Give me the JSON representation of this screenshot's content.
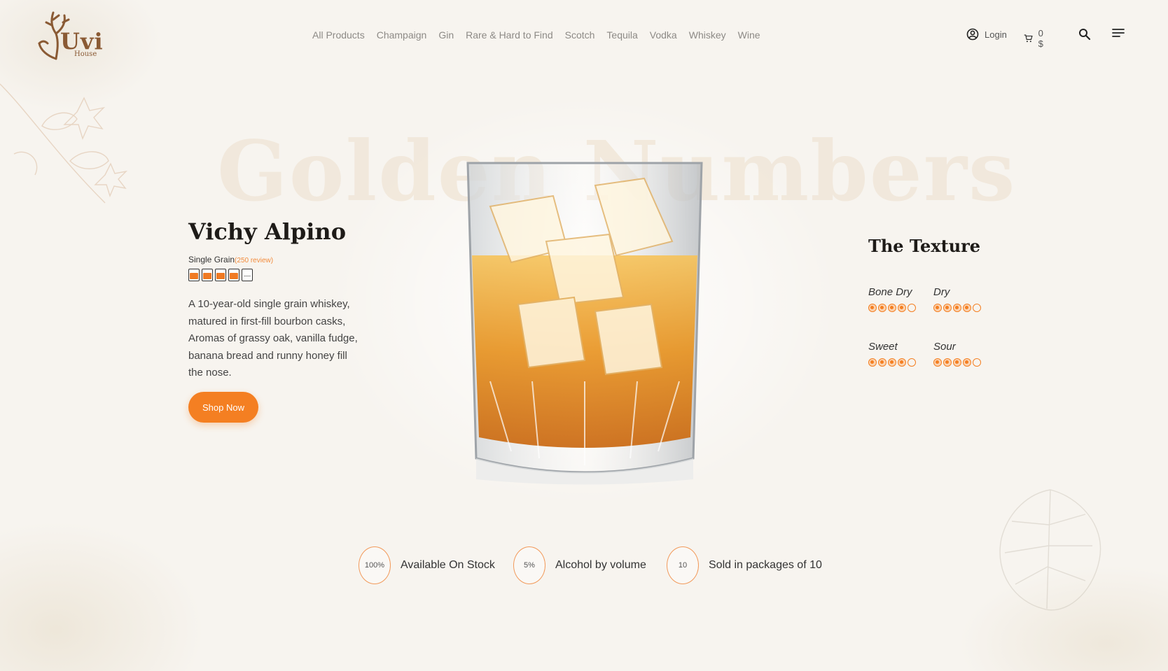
{
  "brand": {
    "logo_text": "Uvi",
    "logo_sub": "House"
  },
  "nav": {
    "items": [
      "All Products",
      "Champaign",
      "Gin",
      "Rare & Hard to Find",
      "Scotch",
      "Tequila",
      "Vodka",
      "Whiskey",
      "Wine"
    ]
  },
  "tools": {
    "login_label": "Login",
    "cart_total": "0 $"
  },
  "hero": {
    "watermark": "Golden Numbers"
  },
  "product": {
    "title": "Vichy Alpino",
    "category": "Single Grain",
    "reviews": "(250 review)",
    "rating": 4,
    "rating_max": 5,
    "description": "A 10-year-old single grain whiskey, matured in first-fill bourbon casks, Aromas of grassy oak, vanilla fudge, banana bread and runny honey fill the nose.",
    "cta_label": "Shop Now"
  },
  "texture": {
    "title": "The Texture",
    "items": [
      {
        "label": "Bone Dry",
        "value": 4,
        "max": 5
      },
      {
        "label": "Dry",
        "value": 4,
        "max": 5
      },
      {
        "label": "Sweet",
        "value": 4,
        "max": 5
      },
      {
        "label": "Sour",
        "value": 4,
        "max": 5
      }
    ]
  },
  "stats": [
    {
      "value": "100%",
      "label": "Available On Stock"
    },
    {
      "value": "5%",
      "label": "Alcohol by volume"
    },
    {
      "value": "10",
      "label": "Sold in packages of 10"
    }
  ],
  "colors": {
    "accent": "#f47f22",
    "brand": "#8a5a34",
    "watermark": "#f1e7d9"
  },
  "icons": {
    "login": "user-circle-icon",
    "cart": "cart-icon",
    "search": "search-icon",
    "menu": "menu-icon"
  }
}
